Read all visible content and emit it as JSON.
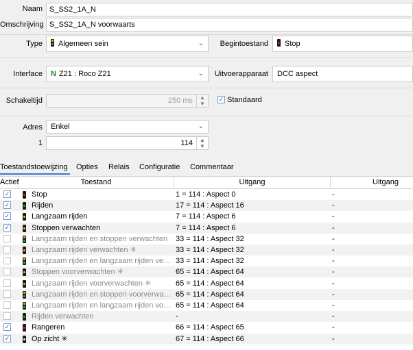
{
  "form": {
    "naam_label": "Naam",
    "naam_value": "S_SS2_1A_N",
    "omschrijving_label": "Omschrijving",
    "omschrijving_value": "S_SS2_1A_N voorwaarts",
    "type_label": "Type",
    "type_value": "Algemeen sein",
    "begintoestand_label": "Begintoestand",
    "begintoestand_value": "Stop",
    "interface_label": "Interface",
    "interface_prefix": "N",
    "interface_value": "Z21 : Roco Z21",
    "uitvoerapparaat_label": "Uitvoerapparaat",
    "uitvoerapparaat_value": "DCC aspect",
    "schakeltijd_label": "Schakeltijd",
    "schakeltijd_value": "250 ms",
    "standaard_label": "Standaard",
    "standaard_checked": true,
    "adres_label": "Adres",
    "adres_value": "Enkel",
    "adres_index": "1",
    "adres_number": "114"
  },
  "tabs": [
    {
      "label": "Toestandstoewijzing",
      "active": true
    },
    {
      "label": "Opties",
      "active": false
    },
    {
      "label": "Relais",
      "active": false
    },
    {
      "label": "Configuratie",
      "active": false
    },
    {
      "label": "Commentaar",
      "active": false
    }
  ],
  "table": {
    "columns": [
      "Actief",
      "Toestand",
      "Uitgang",
      "Uitgang"
    ],
    "rows": [
      {
        "active": true,
        "signal": "red",
        "name": "Stop",
        "out": "1 = 114 : Aspect 0",
        "out2": "-"
      },
      {
        "active": true,
        "signal": "green",
        "name": "Rijden",
        "out": "17 = 114 : Aspect 16",
        "out2": "-"
      },
      {
        "active": true,
        "signal": "yellow",
        "name": "Langzaam rijden",
        "out": "7 = 114 : Aspect 6",
        "out2": "-"
      },
      {
        "active": true,
        "signal": "yellow",
        "name": "Stoppen verwachten",
        "out": "7 = 114 : Aspect 6",
        "out2": "-"
      },
      {
        "active": false,
        "signal": "yellow-green",
        "name": "Langzaam rijden en stoppen verwachten",
        "out": "33 = 114 : Aspect 32",
        "out2": "-"
      },
      {
        "active": false,
        "signal": "yellow",
        "name": "Langzaam rijden verwachten ✳",
        "out": "33 = 114 : Aspect 32",
        "out2": "-"
      },
      {
        "active": false,
        "signal": "yellow-green",
        "name": "Langzaam rijden en langzaam rijden verwachten",
        "out": "33 = 114 : Aspect 32",
        "out2": "-"
      },
      {
        "active": false,
        "signal": "yellow",
        "name": "Stoppen voorverwachten ✳",
        "out": "65 = 114 : Aspect 64",
        "out2": "-"
      },
      {
        "active": false,
        "signal": "yellow",
        "name": "Langzaam rijden voorverwachten ✳",
        "out": "65 = 114 : Aspect 64",
        "out2": "-"
      },
      {
        "active": false,
        "signal": "yellow-green",
        "name": "Langzaam rijden en stoppen voorverwachten",
        "out": "65 = 114 : Aspect 64",
        "out2": "-"
      },
      {
        "active": false,
        "signal": "yellow-green",
        "name": "Langzaam rijden en langzaam rijden voorverwachten",
        "out": "65 = 114 : Aspect 64",
        "out2": "-"
      },
      {
        "active": false,
        "signal": "green",
        "name": "Rijden verwachten",
        "out": "-",
        "out2": "-"
      },
      {
        "active": true,
        "signal": "red",
        "name": "Rangeren",
        "out": "66 = 114 : Aspect 65",
        "out2": "-"
      },
      {
        "active": true,
        "signal": "white",
        "name": "Op zicht ✳",
        "out": "67 = 114 : Aspect 66",
        "out2": "-"
      }
    ]
  },
  "colors": {
    "red": "#e01818",
    "green": "#22b22a",
    "yellow": "#f0c000",
    "white": "#f4f4f4",
    "accent": "#3c78d8"
  }
}
